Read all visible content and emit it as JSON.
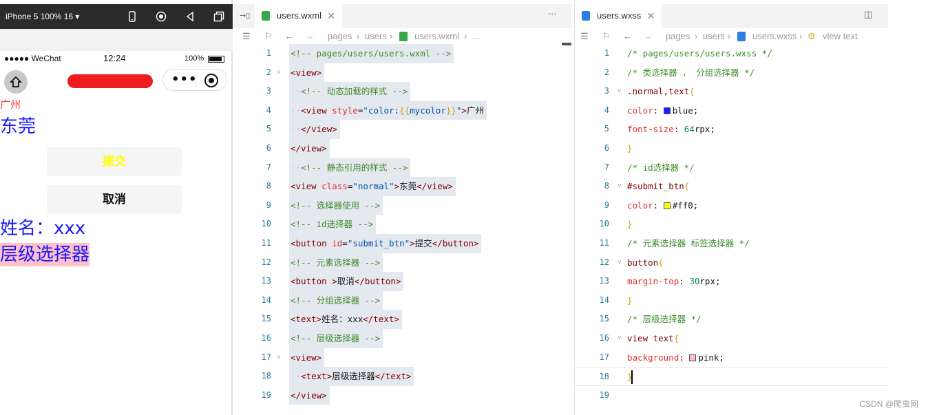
{
  "simulator": {
    "device_label": "iPhone 5 100% 16 ▾",
    "signal": "●●●●● WeChat",
    "time": "12:24",
    "battery": "100%",
    "page": {
      "guangzhou": "广州",
      "dongguan": "东莞",
      "submit": "提交",
      "cancel": "取消",
      "name": "姓名：xxx",
      "level": "层级选择器"
    },
    "colors": {
      "guangzhou": "#f03c3c",
      "normal_text": "#1a1aff",
      "submit_text": "#ffff00",
      "level_bg": "#ffc0cb",
      "redact": "#ee1c1c"
    }
  },
  "editor_wxml": {
    "tab": "users.wxml",
    "crumbs": [
      "pages",
      "users",
      "users.wxml",
      "..."
    ],
    "lines": [
      {
        "n": "1",
        "fold": "",
        "parts": [
          [
            "c-com",
            "<!-- pages/users/users.wxml -->"
          ]
        ]
      },
      {
        "n": "2",
        "fold": "˅",
        "parts": [
          [
            "c-tag",
            "<view>"
          ]
        ]
      },
      {
        "n": "3",
        "fold": "",
        "parts": [
          [
            "c-dot",
            "··"
          ],
          [
            "c-com",
            "<!-- 动态加载的样式 -->"
          ]
        ]
      },
      {
        "n": "4",
        "fold": "",
        "parts": [
          [
            "c-dot",
            "··"
          ],
          [
            "c-tag",
            "<view "
          ],
          [
            "c-attr",
            "style"
          ],
          [
            "c-txt",
            "="
          ],
          [
            "c-val",
            "\"color:"
          ],
          [
            "c-brace",
            "{{"
          ],
          [
            "c-val",
            "mycolor"
          ],
          [
            "c-brace",
            "}}"
          ],
          [
            "c-val",
            "\""
          ],
          [
            "c-tag",
            ">"
          ],
          [
            "c-txt",
            "广州"
          ]
        ]
      },
      {
        "n": "5",
        "fold": "",
        "parts": [
          [
            "c-dot",
            "··"
          ],
          [
            "c-tag",
            "</view>"
          ]
        ]
      },
      {
        "n": "6",
        "fold": "",
        "parts": [
          [
            "c-tag",
            "</view>"
          ]
        ]
      },
      {
        "n": "7",
        "fold": "",
        "parts": [
          [
            "c-dot",
            "··"
          ],
          [
            "c-com",
            "<!-- 静态引用的样式 -->"
          ]
        ]
      },
      {
        "n": "8",
        "fold": "",
        "parts": [
          [
            "c-tag",
            "<view "
          ],
          [
            "c-attr",
            "class"
          ],
          [
            "c-txt",
            "="
          ],
          [
            "c-val",
            "\"normal\""
          ],
          [
            "c-tag",
            ">"
          ],
          [
            "c-txt",
            "东莞"
          ],
          [
            "c-tag",
            "</view>"
          ]
        ]
      },
      {
        "n": "9",
        "fold": "",
        "parts": [
          [
            "c-com",
            "<!-- 选择器使用 -->"
          ]
        ]
      },
      {
        "n": "10",
        "fold": "",
        "parts": [
          [
            "c-com",
            "<!-- id选择器 -->"
          ]
        ]
      },
      {
        "n": "11",
        "fold": "",
        "parts": [
          [
            "c-tag",
            "<button "
          ],
          [
            "c-attr",
            "id"
          ],
          [
            "c-txt",
            "="
          ],
          [
            "c-val",
            "\"submit_btn\""
          ],
          [
            "c-tag",
            ">"
          ],
          [
            "c-txt",
            "提交"
          ],
          [
            "c-tag",
            "</button>"
          ]
        ]
      },
      {
        "n": "12",
        "fold": "",
        "parts": [
          [
            "c-com",
            "<!-- 元素选择器 -->"
          ]
        ]
      },
      {
        "n": "13",
        "fold": "",
        "parts": [
          [
            "c-tag",
            "<button >"
          ],
          [
            "c-txt",
            "取消"
          ],
          [
            "c-tag",
            "</button>"
          ]
        ]
      },
      {
        "n": "14",
        "fold": "",
        "parts": [
          [
            "c-com",
            "<!-- 分组选择器 -->"
          ]
        ]
      },
      {
        "n": "15",
        "fold": "",
        "parts": [
          [
            "c-tag",
            "<text>"
          ],
          [
            "c-txt",
            "姓名：xxx"
          ],
          [
            "c-tag",
            "</text>"
          ]
        ]
      },
      {
        "n": "16",
        "fold": "",
        "parts": [
          [
            "c-com",
            "<!-- 层级选择器 -->"
          ]
        ]
      },
      {
        "n": "17",
        "fold": "˅",
        "parts": [
          [
            "c-tag",
            "<view>"
          ]
        ]
      },
      {
        "n": "18",
        "fold": "",
        "parts": [
          [
            "c-dot",
            "··"
          ],
          [
            "c-tag",
            "<text>"
          ],
          [
            "c-txt",
            "层级选择器"
          ],
          [
            "c-tag",
            "</text>"
          ]
        ]
      },
      {
        "n": "19",
        "fold": "",
        "parts": [
          [
            "c-tag",
            "</view>"
          ]
        ]
      }
    ]
  },
  "editor_wxss": {
    "tab": "users.wxss",
    "crumbs": [
      "pages",
      "users",
      "users.wxss",
      "view text"
    ],
    "lines": [
      {
        "n": "1",
        "fold": "",
        "parts": [
          [
            "c-com",
            "/* pages/users/users.wxss */"
          ]
        ]
      },
      {
        "n": "2",
        "fold": "",
        "parts": [
          [
            "c-com",
            "/* 类选择器 ， 分组选择器 */"
          ]
        ]
      },
      {
        "n": "3",
        "fold": "˅",
        "parts": [
          [
            "c-sel",
            ".normal,text"
          ],
          [
            "c-brace",
            "{"
          ]
        ]
      },
      {
        "n": "4",
        "fold": "",
        "parts": [
          [
            "c-prop",
            "color"
          ],
          [
            "c-pval",
            ": "
          ],
          [
            "swatch",
            "#1a1aff"
          ],
          [
            "c-pval",
            "blue;"
          ]
        ]
      },
      {
        "n": "5",
        "fold": "",
        "parts": [
          [
            "c-prop",
            "font-size"
          ],
          [
            "c-pval",
            ": "
          ],
          [
            "c-num",
            "64"
          ],
          [
            "c-pval",
            "rpx;"
          ]
        ]
      },
      {
        "n": "6",
        "fold": "",
        "parts": [
          [
            "c-brace",
            "}"
          ]
        ]
      },
      {
        "n": "7",
        "fold": "",
        "parts": [
          [
            "c-com",
            "/* id选择器 */"
          ]
        ]
      },
      {
        "n": "8",
        "fold": "˅",
        "parts": [
          [
            "c-sel",
            "#submit_btn"
          ],
          [
            "c-brace",
            "{"
          ]
        ]
      },
      {
        "n": "9",
        "fold": "",
        "parts": [
          [
            "c-prop",
            "color"
          ],
          [
            "c-pval",
            ": "
          ],
          [
            "swatch",
            "#ffff00"
          ],
          [
            "c-pval",
            "#ff0;"
          ]
        ]
      },
      {
        "n": "10",
        "fold": "",
        "parts": [
          [
            "c-brace",
            "}"
          ]
        ]
      },
      {
        "n": "11",
        "fold": "",
        "parts": [
          [
            "c-com",
            "/* 元素选择器 标签选择器 */"
          ]
        ]
      },
      {
        "n": "12",
        "fold": "˅",
        "parts": [
          [
            "c-sel",
            "button"
          ],
          [
            "c-brace",
            "{"
          ]
        ]
      },
      {
        "n": "13",
        "fold": "",
        "parts": [
          [
            "c-dot",
            "  "
          ],
          [
            "c-prop",
            "margin-top"
          ],
          [
            "c-pval",
            ": "
          ],
          [
            "c-num",
            "30"
          ],
          [
            "c-pval",
            "rpx;"
          ]
        ]
      },
      {
        "n": "14",
        "fold": "",
        "parts": [
          [
            "c-brace",
            "}"
          ]
        ]
      },
      {
        "n": "15",
        "fold": "",
        "parts": [
          [
            "c-com",
            "/* 层级选择器 */"
          ]
        ]
      },
      {
        "n": "16",
        "fold": "˅",
        "parts": [
          [
            "c-sel",
            "view text"
          ],
          [
            "c-brace",
            "{"
          ]
        ]
      },
      {
        "n": "17",
        "fold": "",
        "parts": [
          [
            "c-dot",
            "  "
          ],
          [
            "c-prop",
            "background"
          ],
          [
            "c-pval",
            ": "
          ],
          [
            "swatch",
            "#ffc0cb"
          ],
          [
            "c-pval",
            "pink;"
          ]
        ]
      },
      {
        "n": "18",
        "fold": "",
        "parts": [
          [
            "c-brace",
            "}"
          ]
        ]
      },
      {
        "n": "19",
        "fold": "",
        "parts": []
      }
    ]
  },
  "watermark": "CSDN @爬虫网"
}
